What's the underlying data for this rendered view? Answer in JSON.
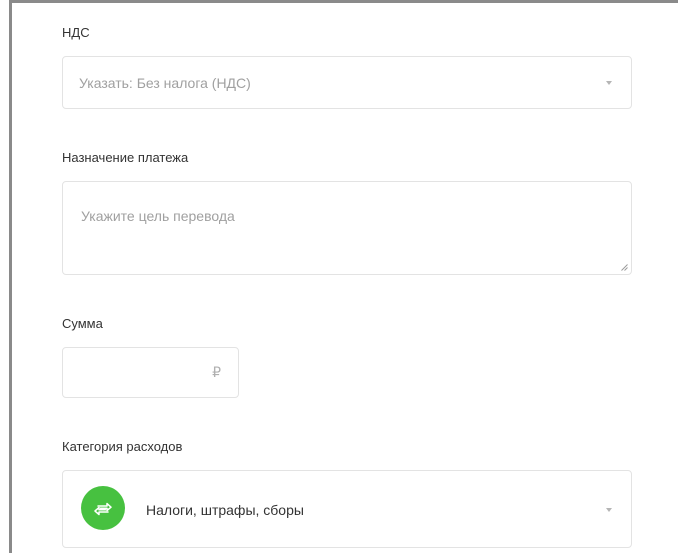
{
  "vat": {
    "label": "НДС",
    "selected": "Указать: Без налога (НДС)"
  },
  "purpose": {
    "label": "Назначение платежа",
    "placeholder": "Укажите цель перевода"
  },
  "amount": {
    "label": "Сумма",
    "value": "",
    "currency_symbol": "₽"
  },
  "expense_category": {
    "label": "Категория расходов",
    "selected": "Налоги, штрафы, сборы",
    "icon": "transfer-arrows-icon",
    "icon_color": "#47c140"
  },
  "icons": {
    "dropdown": "caret-down-icon",
    "resize": "resize-handle-icon"
  },
  "colors": {
    "border": "#e3e3e3",
    "placeholder": "#a0a0a0",
    "accent": "#47c140"
  }
}
